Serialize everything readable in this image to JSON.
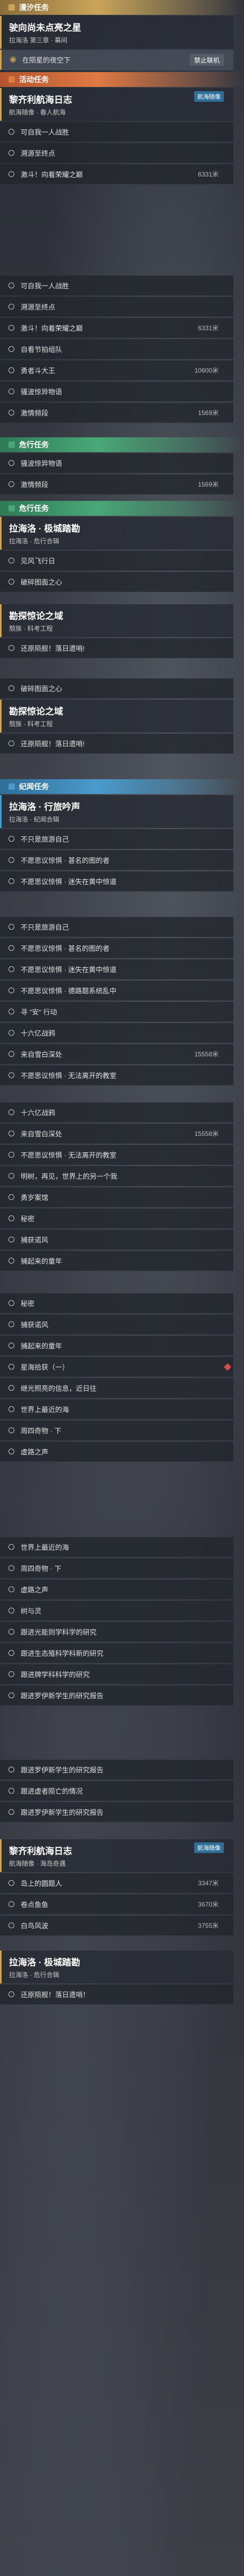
{
  "colors": {
    "gold": "#caa55a",
    "orange": "#e07a43",
    "green": "#49a877",
    "blue": "#4a9bcc"
  },
  "sections": {
    "s1": "漫汐任务",
    "s2": "活动任务",
    "s3": "危行任务",
    "s4": "危行任务",
    "s5": "纪闻任务"
  },
  "cards": {
    "c1": {
      "title": "驶向尚未点亮之星",
      "sub": "拉海洛 第三章 · 幕间"
    },
    "c2": {
      "title": "黎齐利航海日志",
      "sub": "航海随像 · 春人航海"
    },
    "c3": {
      "title": "拉海洛 · 极城踏勘",
      "sub": "拉海洛 · 危行合辑"
    },
    "c4": {
      "title": "勘探惊论之域",
      "sub": "颓族 · 科考工程"
    },
    "c5": {
      "title": "勘探惊论之域",
      "sub": "颓族 · 科考工程"
    },
    "c6": {
      "title": "拉海洛 · 行旅吟声",
      "sub": "拉海洛 · 纪闻合辑"
    },
    "c7": {
      "title": "黎齐利航海日志",
      "sub": "航海随像 · 海岛奇遇"
    },
    "c8": {
      "title": "拉海洛 · 极城踏勘",
      "sub": "拉海洛 · 危行合辑"
    }
  },
  "buttons": {
    "track": "禁止联机",
    "nav": "航海随像",
    "nav2": "航海随像"
  },
  "rows": [
    {
      "label": "在陨星的夜空下",
      "dist": ""
    },
    {
      "label": "可自我一人战胜",
      "dist": ""
    },
    {
      "label": "溯源至终点",
      "dist": ""
    },
    {
      "label": "激斗！向着荣耀之巅",
      "dist": "6331米"
    },
    {
      "label": "可自我一人战胜",
      "dist": ""
    },
    {
      "label": "溯源至终点",
      "dist": ""
    },
    {
      "label": "激斗！向着荣耀之巅",
      "dist": "6331米"
    },
    {
      "label": "自看节拍组队",
      "dist": ""
    },
    {
      "label": "勇者斗大王",
      "dist": "10600米"
    },
    {
      "label": "骚波惊异物语",
      "dist": ""
    },
    {
      "label": "激情频段",
      "dist": "1569米"
    },
    {
      "label": "骚波惊异物语",
      "dist": ""
    },
    {
      "label": "激情频段",
      "dist": "1569米"
    },
    {
      "label": "见风飞行日",
      "dist": ""
    },
    {
      "label": "破碎图面之心",
      "dist": ""
    },
    {
      "label": "还原陨舰！落日遗哨!",
      "dist": ""
    },
    {
      "label": "破碎图面之心",
      "dist": ""
    },
    {
      "label": "还原陨舰！落日遗哨!",
      "dist": ""
    },
    {
      "label": "不只是旅游自己",
      "dist": ""
    },
    {
      "label": "不愿思议惊惧 · 甚名的图的者",
      "dist": ""
    },
    {
      "label": "不愿思议惊惧 · 迷失在黄中惊道",
      "dist": ""
    },
    {
      "label": "不只是旅游自己",
      "dist": ""
    },
    {
      "label": "不愿思议惊惧 · 甚名的图的者",
      "dist": ""
    },
    {
      "label": "不愿思议惊惧 · 迷失在黄中惊道",
      "dist": ""
    },
    {
      "label": "不愿思议惊惧 · 德路题系统乱中",
      "dist": ""
    },
    {
      "label": "寻 \"安\" 行动",
      "dist": ""
    },
    {
      "label": "十六亿战鸦",
      "dist": ""
    },
    {
      "label": "来自雪白深处",
      "dist": "15558米"
    },
    {
      "label": "不愿思议惊惧 · 无法离开的教室",
      "dist": ""
    },
    {
      "label": "十六亿战鸦",
      "dist": ""
    },
    {
      "label": "来自雪白深处",
      "dist": "15558米"
    },
    {
      "label": "不愿思议惊惧 · 无法离开的教室",
      "dist": ""
    },
    {
      "label": "明树，再见，世界上的另一个我",
      "dist": ""
    },
    {
      "label": "勇岁案馆",
      "dist": ""
    },
    {
      "label": "秘密",
      "dist": ""
    },
    {
      "label": "捕获诺风",
      "dist": ""
    },
    {
      "label": "捕起来的童年",
      "dist": ""
    },
    {
      "label": "秘密",
      "dist": ""
    },
    {
      "label": "捕获诺风",
      "dist": ""
    },
    {
      "label": "捕起来的童年",
      "dist": ""
    },
    {
      "label": "星海拾获（一）",
      "dist": ""
    },
    {
      "label": "继光照亮的信息，近日往",
      "dist": ""
    },
    {
      "label": "世界上最近的海",
      "dist": ""
    },
    {
      "label": "周四奇物 · 下",
      "dist": ""
    },
    {
      "label": "虚路之声",
      "dist": ""
    },
    {
      "label": "世界上最近的海",
      "dist": ""
    },
    {
      "label": "周四奇物 · 下",
      "dist": ""
    },
    {
      "label": "虚路之声",
      "dist": ""
    },
    {
      "label": "树与灵",
      "dist": ""
    },
    {
      "label": "跟进光能则学科学的研究",
      "dist": ""
    },
    {
      "label": "跟进生态殖科学科新的研究",
      "dist": ""
    },
    {
      "label": "跟进牌学科科学的研究",
      "dist": ""
    },
    {
      "label": "跟进罗伊新学生的研究报告",
      "dist": ""
    },
    {
      "label": "跟进罗伊新学生的研究报告",
      "dist": ""
    },
    {
      "label": "跟进虚者陨亡的情况",
      "dist": ""
    },
    {
      "label": "跟进罗伊新学生的研究报告",
      "dist": ""
    },
    {
      "label": "岛上的圆题人",
      "dist": "3347米"
    },
    {
      "label": "卷点鱼鱼",
      "dist": "3670米"
    },
    {
      "label": "白鸟风波",
      "dist": "3755米"
    },
    {
      "label": "还原陨舰！落日遗哨！",
      "dist": ""
    }
  ]
}
